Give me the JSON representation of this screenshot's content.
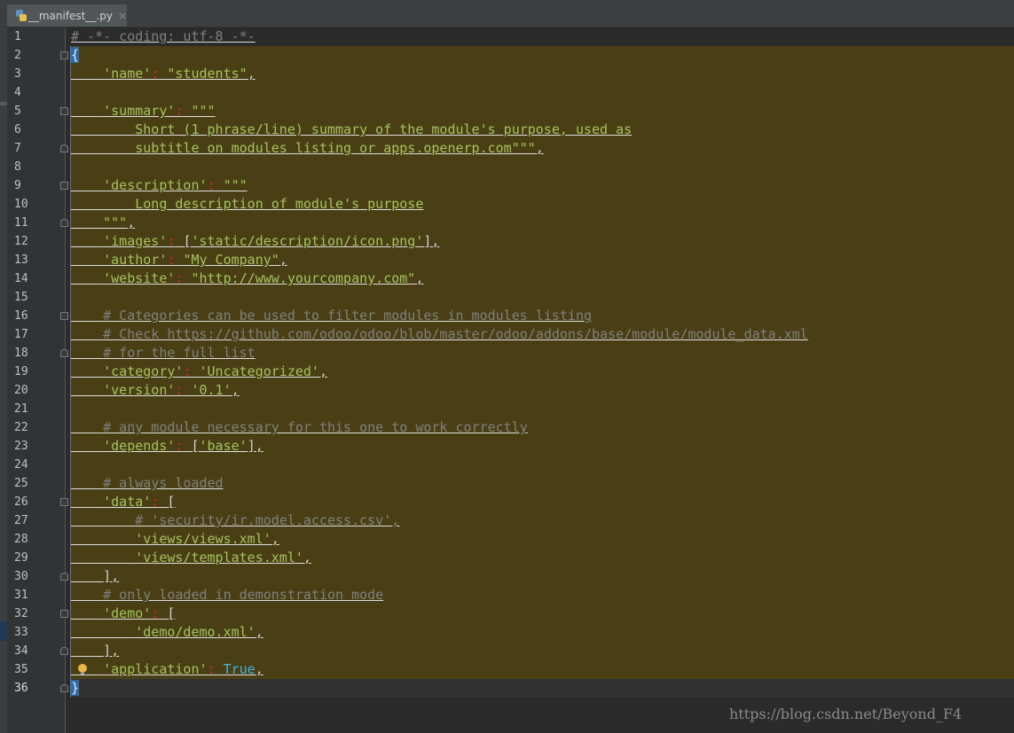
{
  "tab": {
    "filename": "__manifest__.py",
    "close_glyph": "×",
    "icon": "python-file-icon"
  },
  "lines": [
    {
      "n": "1",
      "segs": [
        [
          "cmt",
          "# -*- coding: utf-8 -*-"
        ]
      ]
    },
    {
      "n": "2",
      "segs": [
        [
          "brace",
          "{"
        ]
      ],
      "fold": "open"
    },
    {
      "n": "3",
      "segs": [
        [
          "sp",
          "    "
        ],
        [
          "key",
          "'name'"
        ],
        [
          "colon",
          ":"
        ],
        [
          "sp",
          " "
        ],
        [
          "str",
          "\"students\""
        ],
        [
          "punc",
          ","
        ]
      ]
    },
    {
      "n": "4",
      "segs": []
    },
    {
      "n": "5",
      "segs": [
        [
          "sp",
          "    "
        ],
        [
          "key",
          "'summary'"
        ],
        [
          "colon",
          ":"
        ],
        [
          "sp",
          " "
        ],
        [
          "str",
          "\"\"\""
        ]
      ],
      "fold": "open"
    },
    {
      "n": "6",
      "segs": [
        [
          "sp",
          "        "
        ],
        [
          "str",
          "Short (1 phrase/line) summary of the module's purpose, used as"
        ]
      ]
    },
    {
      "n": "7",
      "segs": [
        [
          "sp",
          "        "
        ],
        [
          "str",
          "subtitle on modules listing or apps.openerp.com\"\"\""
        ],
        [
          "punc",
          ","
        ]
      ],
      "fold": "close"
    },
    {
      "n": "8",
      "segs": []
    },
    {
      "n": "9",
      "segs": [
        [
          "sp",
          "    "
        ],
        [
          "key",
          "'description'"
        ],
        [
          "colon",
          ":"
        ],
        [
          "sp",
          " "
        ],
        [
          "str",
          "\"\"\""
        ]
      ],
      "fold": "open"
    },
    {
      "n": "10",
      "segs": [
        [
          "sp",
          "        "
        ],
        [
          "str",
          "Long description of module's purpose"
        ]
      ]
    },
    {
      "n": "11",
      "segs": [
        [
          "sp",
          "    "
        ],
        [
          "str",
          "\"\"\""
        ],
        [
          "punc",
          ","
        ]
      ],
      "fold": "close"
    },
    {
      "n": "12",
      "segs": [
        [
          "sp",
          "    "
        ],
        [
          "key",
          "'images'"
        ],
        [
          "colon",
          ":"
        ],
        [
          "sp",
          " "
        ],
        [
          "punc",
          "["
        ],
        [
          "str",
          "'static/description/icon.png'"
        ],
        [
          "punc",
          "],"
        ]
      ]
    },
    {
      "n": "13",
      "segs": [
        [
          "sp",
          "    "
        ],
        [
          "key",
          "'author'"
        ],
        [
          "colon",
          ":"
        ],
        [
          "sp",
          " "
        ],
        [
          "str",
          "\"My Company\""
        ],
        [
          "punc",
          ","
        ]
      ]
    },
    {
      "n": "14",
      "segs": [
        [
          "sp",
          "    "
        ],
        [
          "key",
          "'website'"
        ],
        [
          "colon",
          ":"
        ],
        [
          "sp",
          " "
        ],
        [
          "str",
          "\"http://www.yourcompany.com\""
        ],
        [
          "punc",
          ","
        ]
      ]
    },
    {
      "n": "15",
      "segs": []
    },
    {
      "n": "16",
      "segs": [
        [
          "sp",
          "    "
        ],
        [
          "cmt",
          "# Categories can be used to filter modules in modules listing"
        ]
      ],
      "fold": "open"
    },
    {
      "n": "17",
      "segs": [
        [
          "sp",
          "    "
        ],
        [
          "cmt",
          "# Check https://github.com/odoo/odoo/blob/master/odoo/addons/base/module/module_data.xml"
        ]
      ]
    },
    {
      "n": "18",
      "segs": [
        [
          "sp",
          "    "
        ],
        [
          "cmt",
          "# for the full list"
        ]
      ],
      "fold": "close"
    },
    {
      "n": "19",
      "segs": [
        [
          "sp",
          "    "
        ],
        [
          "key",
          "'category'"
        ],
        [
          "colon",
          ":"
        ],
        [
          "sp",
          " "
        ],
        [
          "str",
          "'Uncategorized'"
        ],
        [
          "punc",
          ","
        ]
      ]
    },
    {
      "n": "20",
      "segs": [
        [
          "sp",
          "    "
        ],
        [
          "key",
          "'version'"
        ],
        [
          "colon",
          ":"
        ],
        [
          "sp",
          " "
        ],
        [
          "str",
          "'0.1'"
        ],
        [
          "punc",
          ","
        ]
      ]
    },
    {
      "n": "21",
      "segs": []
    },
    {
      "n": "22",
      "segs": [
        [
          "sp",
          "    "
        ],
        [
          "cmt",
          "# any module necessary for this one to work correctly"
        ]
      ]
    },
    {
      "n": "23",
      "segs": [
        [
          "sp",
          "    "
        ],
        [
          "key",
          "'depends'"
        ],
        [
          "colon",
          ":"
        ],
        [
          "sp",
          " "
        ],
        [
          "punc",
          "["
        ],
        [
          "str",
          "'base'"
        ],
        [
          "punc",
          "],"
        ]
      ]
    },
    {
      "n": "24",
      "segs": []
    },
    {
      "n": "25",
      "segs": [
        [
          "sp",
          "    "
        ],
        [
          "cmt",
          "# always loaded"
        ]
      ]
    },
    {
      "n": "26",
      "segs": [
        [
          "sp",
          "    "
        ],
        [
          "key",
          "'data'"
        ],
        [
          "colon",
          ":"
        ],
        [
          "sp",
          " "
        ],
        [
          "punc",
          "["
        ]
      ],
      "fold": "open"
    },
    {
      "n": "27",
      "segs": [
        [
          "sp",
          "        "
        ],
        [
          "cmt",
          "# 'security/ir.model.access.csv',"
        ]
      ]
    },
    {
      "n": "28",
      "segs": [
        [
          "sp",
          "        "
        ],
        [
          "str",
          "'views/views.xml'"
        ],
        [
          "punc",
          ","
        ]
      ]
    },
    {
      "n": "29",
      "segs": [
        [
          "sp",
          "        "
        ],
        [
          "str",
          "'views/templates.xml'"
        ],
        [
          "punc",
          ","
        ]
      ]
    },
    {
      "n": "30",
      "segs": [
        [
          "sp",
          "    "
        ],
        [
          "punc",
          "],"
        ]
      ],
      "fold": "close"
    },
    {
      "n": "31",
      "segs": [
        [
          "sp",
          "    "
        ],
        [
          "cmt",
          "# only loaded in demonstration mode"
        ]
      ]
    },
    {
      "n": "32",
      "segs": [
        [
          "sp",
          "    "
        ],
        [
          "key",
          "'demo'"
        ],
        [
          "colon",
          ":"
        ],
        [
          "sp",
          " "
        ],
        [
          "punc",
          "["
        ]
      ],
      "fold": "open"
    },
    {
      "n": "33",
      "segs": [
        [
          "sp",
          "        "
        ],
        [
          "str",
          "'demo/demo.xml'"
        ],
        [
          "punc",
          ","
        ]
      ]
    },
    {
      "n": "34",
      "segs": [
        [
          "sp",
          "    "
        ],
        [
          "punc",
          "],"
        ]
      ],
      "fold": "close"
    },
    {
      "n": "35",
      "segs": [
        [
          "sp",
          "    "
        ],
        [
          "key",
          "'application'"
        ],
        [
          "colon",
          ":"
        ],
        [
          "sp",
          " "
        ],
        [
          "kw",
          "True"
        ],
        [
          "punc",
          ","
        ]
      ],
      "bulb": true
    },
    {
      "n": "36",
      "segs": [
        [
          "brace",
          "}"
        ]
      ],
      "fold": "close",
      "current": true
    }
  ],
  "watermark": "https://blog.csdn.net/Beyond_F4",
  "colors": {
    "editor_bg": "#2b2b2b",
    "highlight_bg": "#4a3f14",
    "string": "#a5c261",
    "comment": "#808080",
    "colon": "#cc2244",
    "keyword": "#46b4d8"
  }
}
